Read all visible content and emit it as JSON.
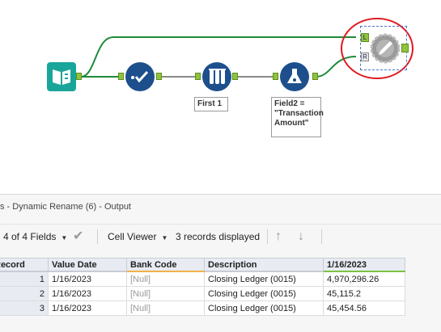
{
  "workflow": {
    "annotations": {
      "sample": "First 1",
      "formula_line1": "Field2 =",
      "formula_line2": "\"Transaction",
      "formula_line3": "Amount\""
    },
    "anchors": {
      "left": "L",
      "right": "R"
    },
    "colors": {
      "connection": "#1f8a3a",
      "tool_blue": "#1d4f8c",
      "input_green": "#1aa59a",
      "highlight_ring": "#e0181e"
    }
  },
  "results": {
    "title": "s - Dynamic Rename (6) - Output",
    "fields_label": "4 of 4 Fields",
    "viewer_label": "Cell Viewer",
    "records_label": "3 records displayed",
    "columns": [
      "Record",
      "Value Date",
      "Bank Code",
      "Description",
      "1/16/2023"
    ],
    "rows": [
      {
        "record": "1",
        "value_date": "1/16/2023",
        "bank_code": "[Null]",
        "description": "Closing Ledger (0015)",
        "amount": "4,970,296.26"
      },
      {
        "record": "2",
        "value_date": "1/16/2023",
        "bank_code": "[Null]",
        "description": "Closing Ledger (0015)",
        "amount": "45,115.2"
      },
      {
        "record": "3",
        "value_date": "1/16/2023",
        "bank_code": "[Null]",
        "description": "Closing Ledger (0015)",
        "amount": "45,454.56"
      }
    ]
  }
}
